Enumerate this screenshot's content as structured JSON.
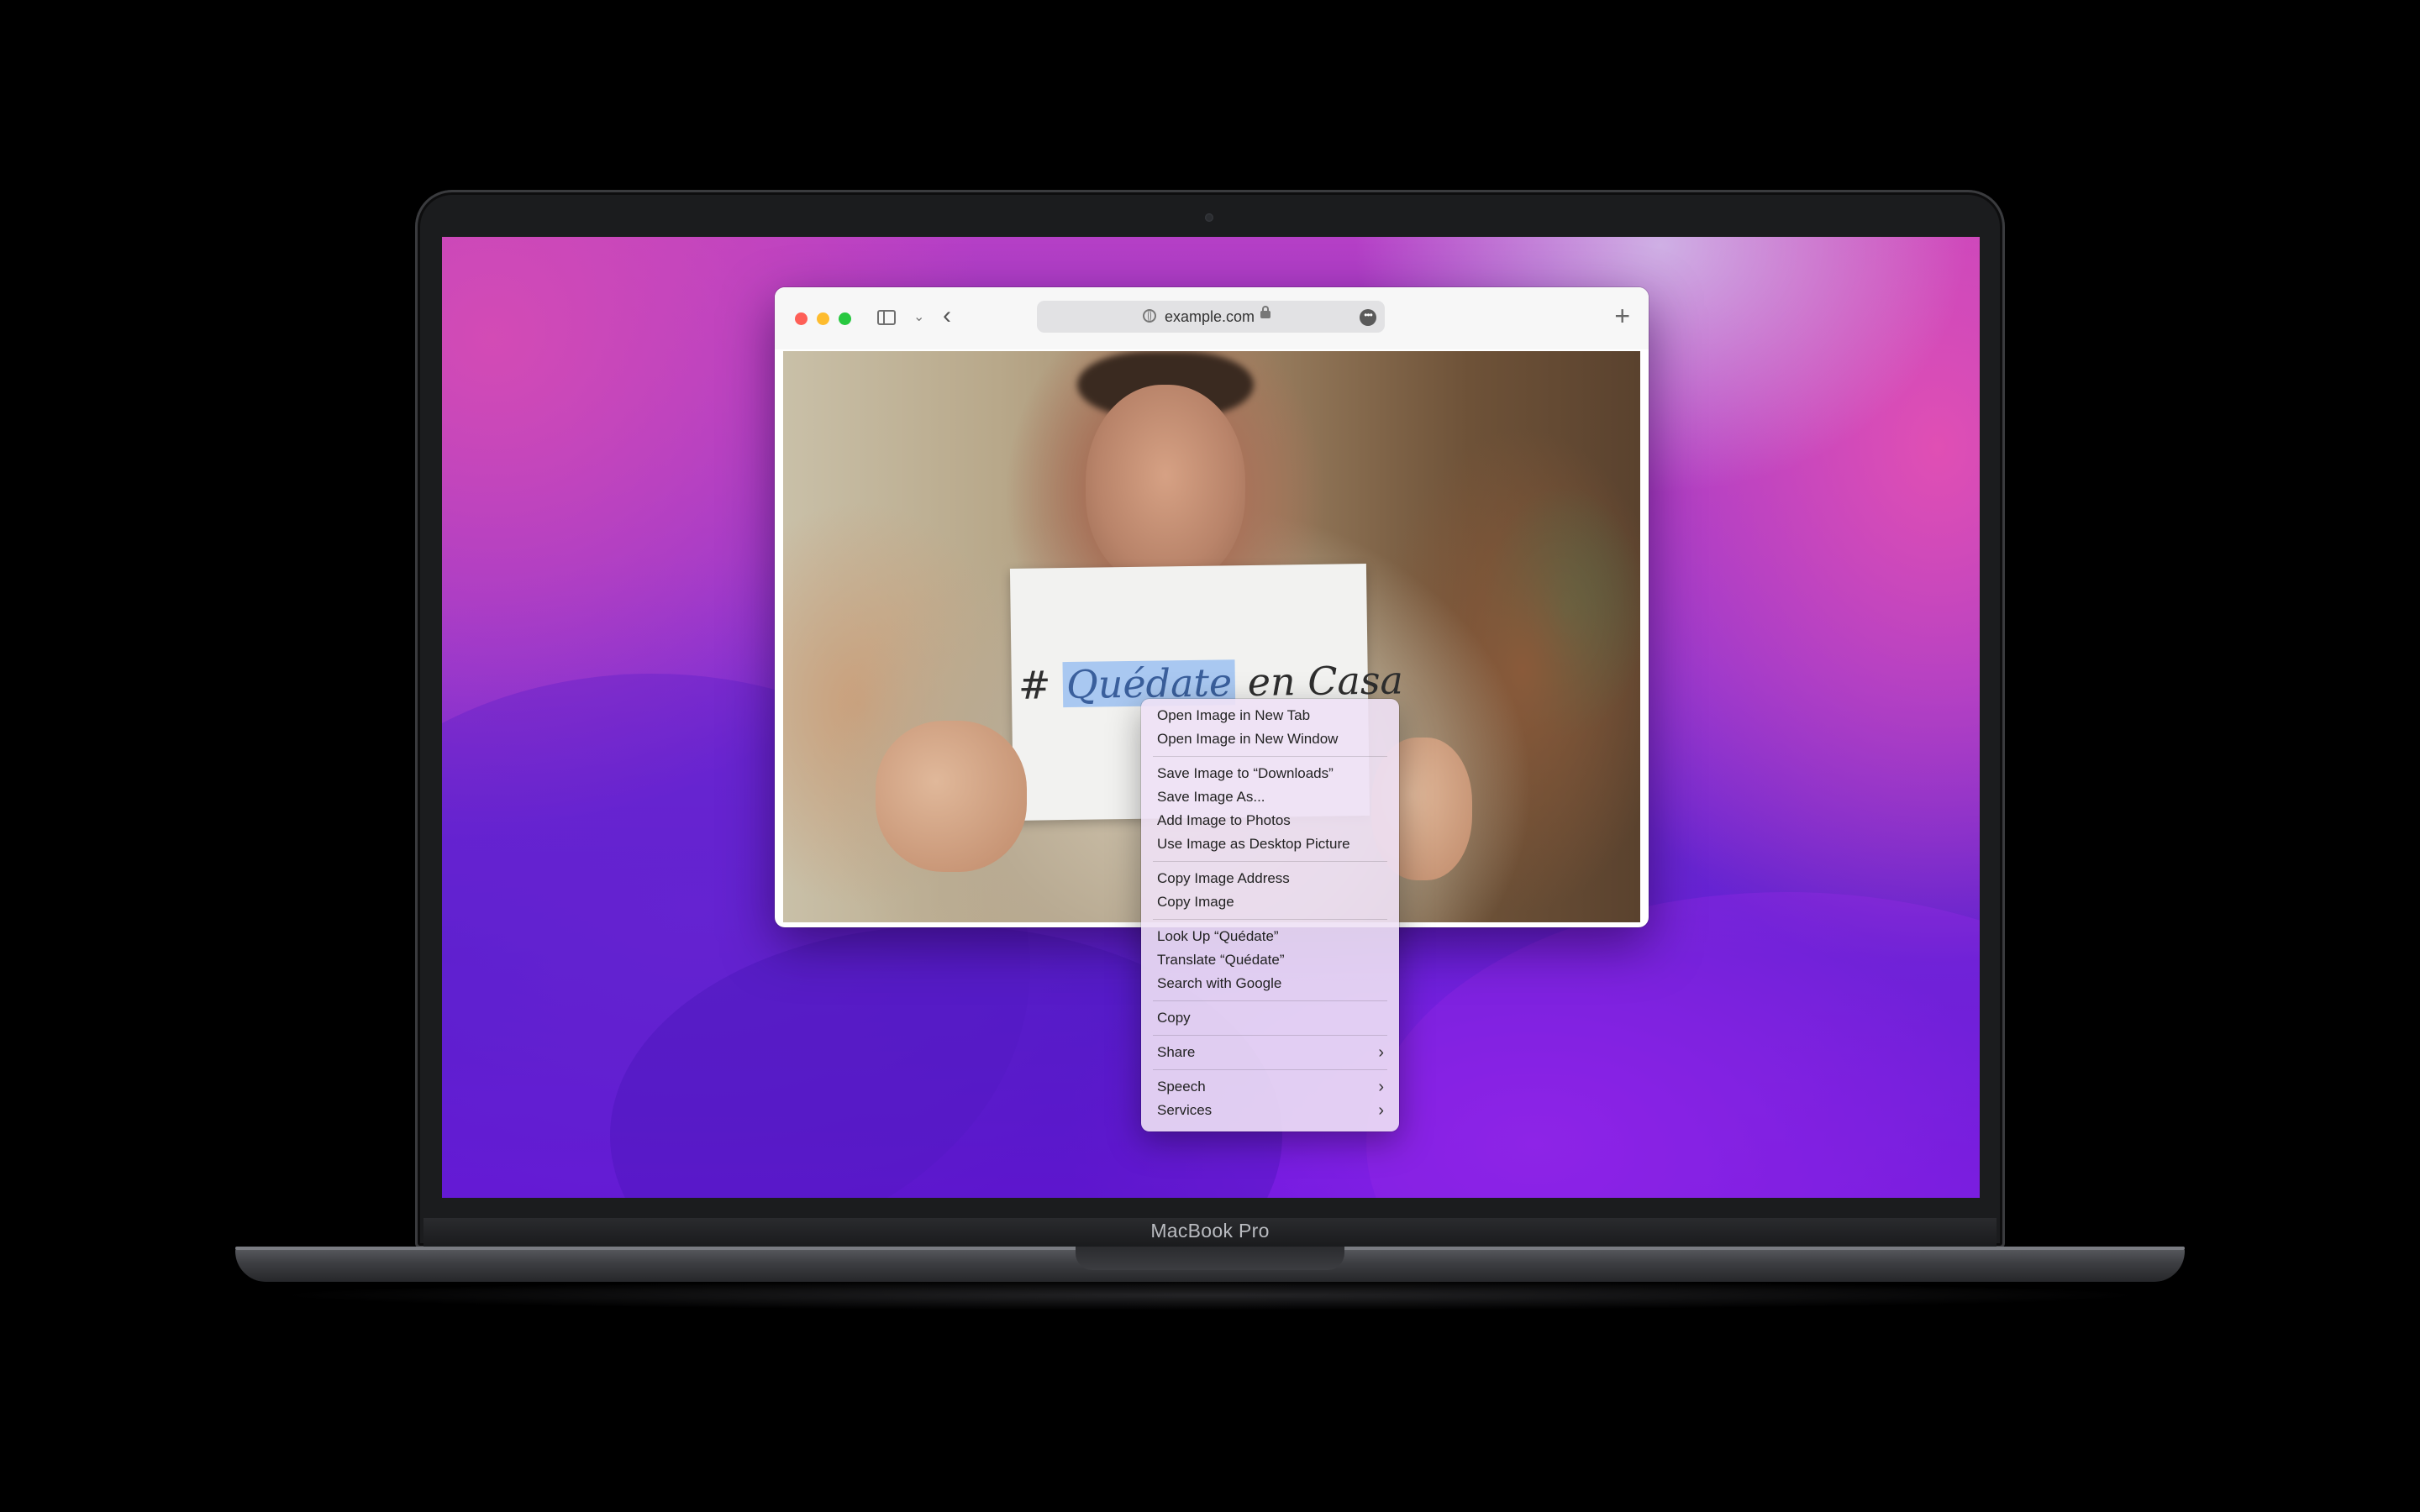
{
  "browser": {
    "address": "example.com"
  },
  "photo": {
    "sign_prefix": "# ",
    "sign_selected": "Quédate",
    "sign_suffix": " en Casa"
  },
  "context_menu": {
    "items": [
      {
        "label": "Open Image in New Tab"
      },
      {
        "label": "Open Image in New Window"
      },
      {
        "label": "Save Image to “Downloads”"
      },
      {
        "label": "Save Image As..."
      },
      {
        "label": "Add Image to Photos"
      },
      {
        "label": "Use Image as Desktop Picture"
      },
      {
        "label": "Copy Image Address"
      },
      {
        "label": "Copy Image"
      },
      {
        "label": "Look Up “Quédate”"
      },
      {
        "label": "Translate “Quédate”"
      },
      {
        "label": "Search with Google"
      },
      {
        "label": "Copy"
      },
      {
        "label": "Share"
      },
      {
        "label": "Speech"
      },
      {
        "label": "Services"
      }
    ]
  },
  "device": {
    "label": "MacBook Pro"
  }
}
